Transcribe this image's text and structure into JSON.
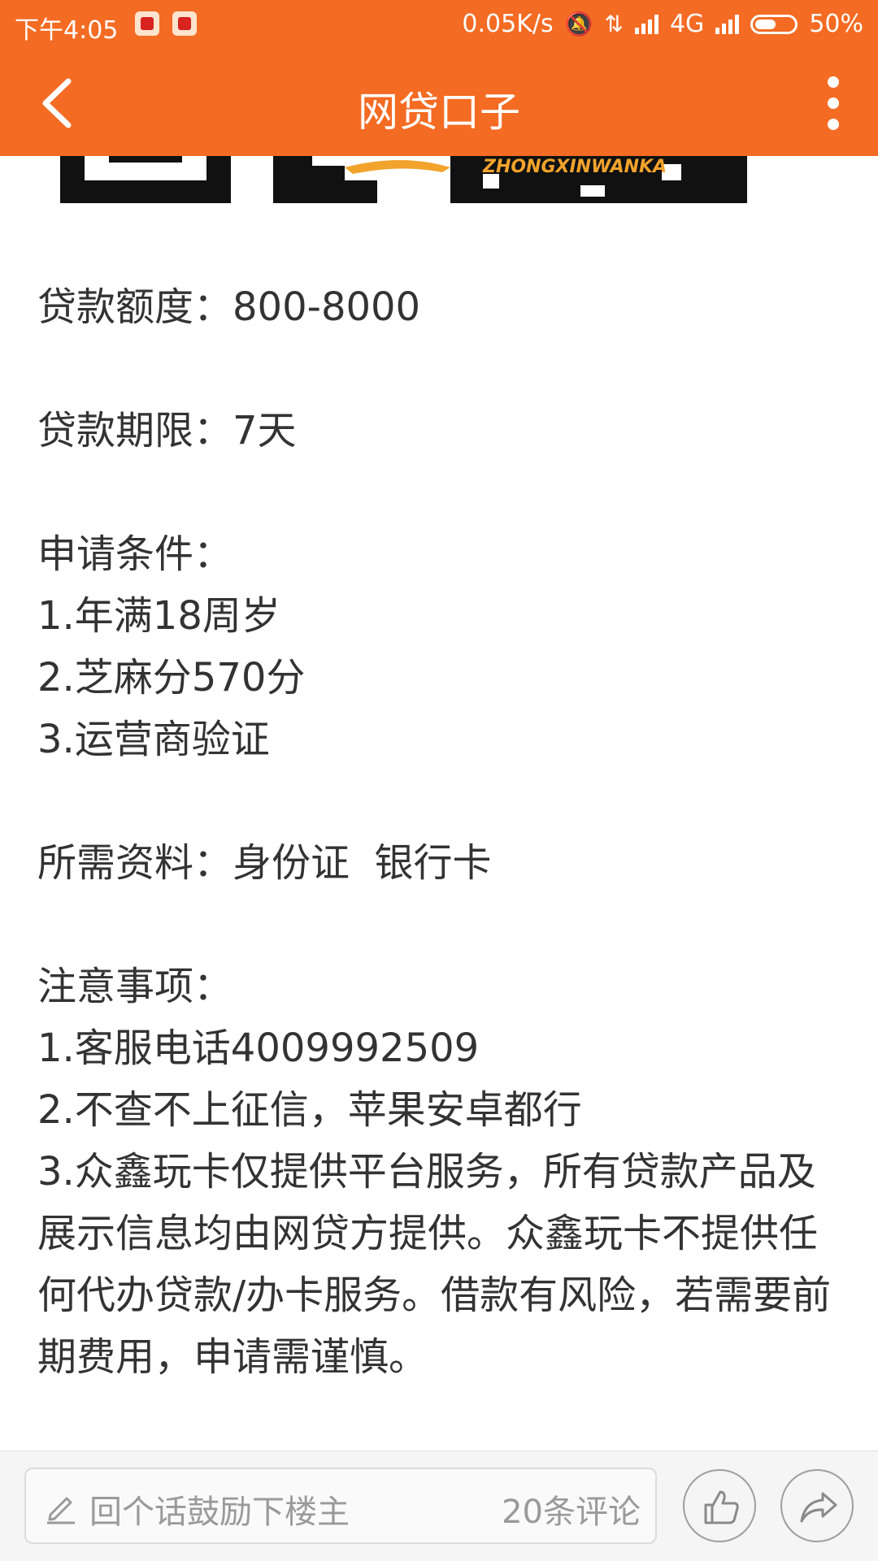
{
  "status_bar": {
    "time": "下午4:05",
    "network_speed": "0.05K/s",
    "network_type": "4G",
    "battery": "50%"
  },
  "header": {
    "title": "网贷口子",
    "back_icon": "back-arrow-icon",
    "more_icon": "more-vertical-icon",
    "color": "#f46b23"
  },
  "banner": {
    "partial_text": "ZHONGXINWANKA"
  },
  "content": {
    "loan_amount": "贷款额度：800-8000",
    "loan_term": "贷款期限：7天",
    "conditions_title": "申请条件：",
    "conditions": [
      "1.年满18周岁",
      "2.芝麻分570分",
      "3.运营商验证"
    ],
    "materials": "所需资料：身份证  银行卡",
    "notes_title": "注意事项：",
    "notes": [
      "1.客服电话4009992509",
      "2.不查不上征信，苹果安卓都行",
      "3.众鑫玩卡仅提供平台服务，所有贷款产品及展示信息均由网贷方提供。众鑫玩卡不提供任何代办贷款/办卡服务。借款有风险，若需要前期费用，申请需谨慎。"
    ]
  },
  "bottom_bar": {
    "comment_placeholder": "回个话鼓励下楼主",
    "comment_count": "20条评论",
    "like_icon": "thumbs-up-icon",
    "share_icon": "share-arrow-icon"
  }
}
